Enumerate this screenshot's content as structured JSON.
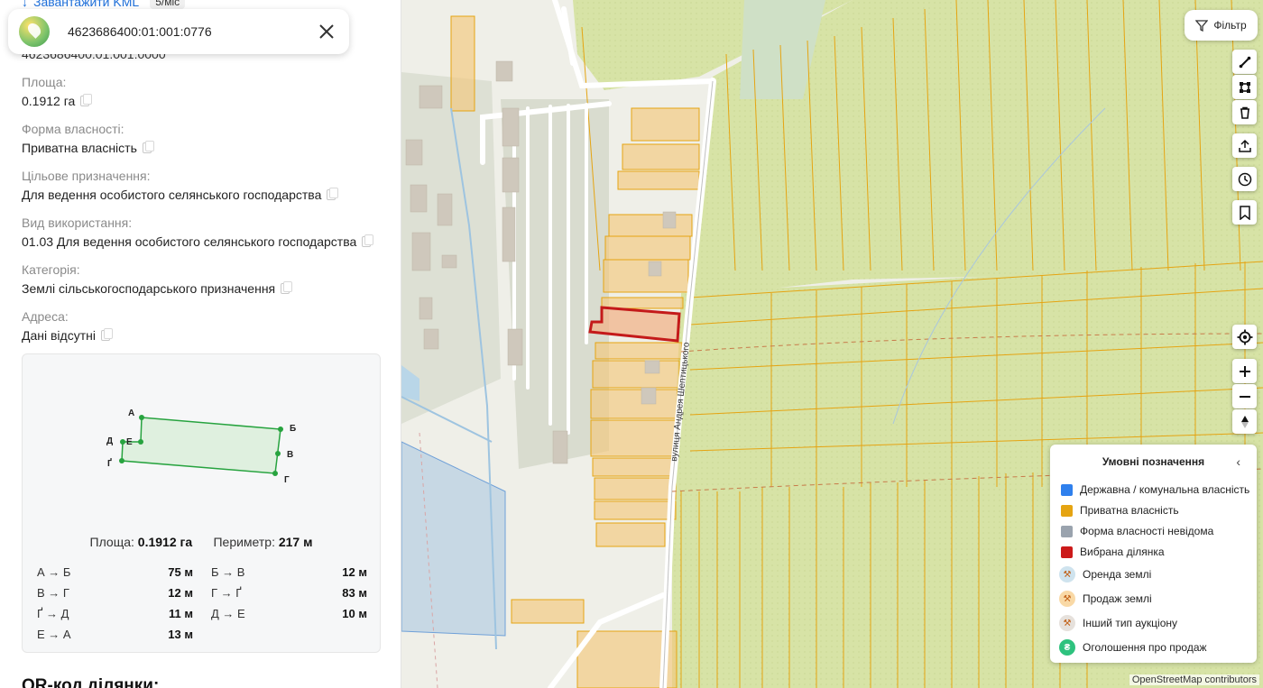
{
  "panel": {
    "download_link": "Завантажити KML",
    "download_badge": "5/міс",
    "search_value": "4623686400:01:001:0776",
    "under_search": "4623686400:01:001:0000",
    "fields": [
      {
        "label": "Площа:",
        "value": "0.1912 га"
      },
      {
        "label": "Форма власності:",
        "value": "Приватна власність"
      },
      {
        "label": "Цільове призначення:",
        "value": "Для ведення особистого селянського господарства"
      },
      {
        "label": "Вид використання:",
        "value": "01.03 Для ведення особистого селянського господарства"
      },
      {
        "label": "Категорія:",
        "value": "Землі сільськогосподарського призначення"
      },
      {
        "label": "Адреса:",
        "value": "Дані відсутні"
      }
    ],
    "shape": {
      "vertices": [
        "А",
        "Б",
        "В",
        "Г",
        "Ґ",
        "Д",
        "Е"
      ],
      "area_label": "Площа:",
      "area_value": "0.1912 га",
      "perimeter_label": "Периметр:",
      "perimeter_value": "217 м",
      "segments": [
        [
          {
            "name": "А → Б",
            "len": "75 м"
          },
          {
            "name": "Б → В",
            "len": "12 м"
          }
        ],
        [
          {
            "name": "В → Г",
            "len": "12 м"
          },
          {
            "name": "Г → Ґ",
            "len": "83 м"
          }
        ],
        [
          {
            "name": "Ґ → Д",
            "len": "11 м"
          },
          {
            "name": "Д → Е",
            "len": "10 м"
          }
        ],
        [
          {
            "name": "Е → А",
            "len": "13 м"
          },
          {
            "name": "",
            "len": ""
          }
        ]
      ]
    },
    "qr_title": "QR-код ділянки:"
  },
  "map": {
    "filter_label": "Фільтр",
    "street_label": "вулиця Андрея Шептицького",
    "attribution": "OpenStreetMap contributors",
    "legend": {
      "title": "Умовні позначення",
      "items": [
        {
          "label": "Державна / комунальна власність",
          "color": "#2f80ed"
        },
        {
          "label": "Приватна власність",
          "color": "#e5a412"
        },
        {
          "label": "Форма власності невідома",
          "color": "#9aa3ae"
        },
        {
          "label": "Вибрана ділянка",
          "color": "#cc1a1a"
        },
        {
          "label": "Оренда землі",
          "color": "#cfe3ee"
        },
        {
          "label": "Продаж землі",
          "color": "#f9d9a6"
        },
        {
          "label": "Інший тип аукціону",
          "color": "#e6e1dc"
        },
        {
          "label": "Оголошення про продаж",
          "color": "#2ec27e"
        }
      ]
    }
  }
}
